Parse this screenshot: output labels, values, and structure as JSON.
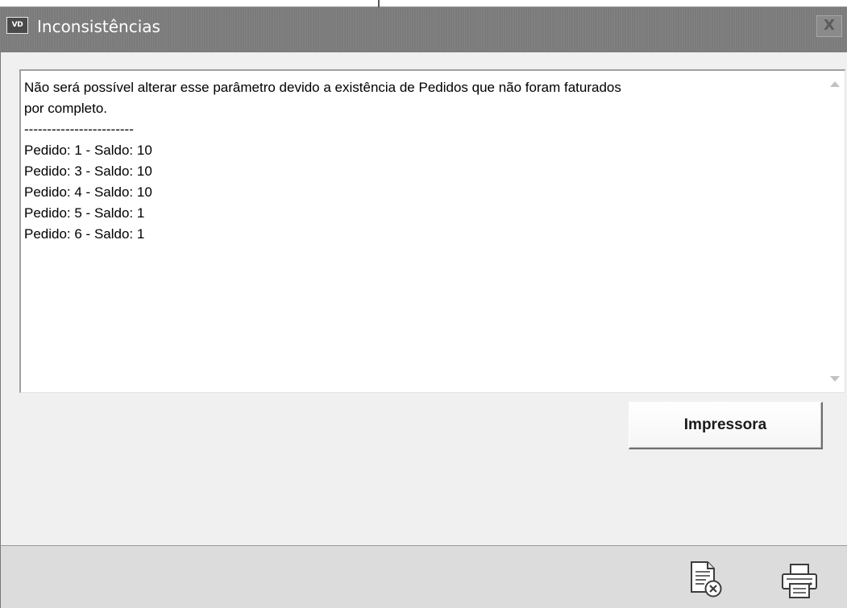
{
  "window": {
    "app_icon_text": "VD",
    "title": "Inconsistências",
    "close_label": "X",
    "close_icon": "close-icon"
  },
  "message": {
    "text": "Não será possível alterar esse parâmetro devido a existência de Pedidos que não foram faturados\npor completo.\n------------------------\nPedido: 1 - Saldo: 10\nPedido: 3 - Saldo: 10\nPedido: 4 - Saldo: 10\nPedido: 5 - Saldo: 1\nPedido: 6 - Saldo: 1",
    "scroll_up_icon": "scroll-up-arrow-icon",
    "scroll_down_icon": "scroll-down-arrow-icon"
  },
  "buttons": {
    "print_label": "Impressora"
  },
  "footer": {
    "icons": [
      "cancel-document-icon",
      "printer-icon"
    ]
  },
  "colors": {
    "titlebar": "#7b7b7b",
    "body": "#f0f0f0",
    "footer": "#dcdcdc"
  }
}
